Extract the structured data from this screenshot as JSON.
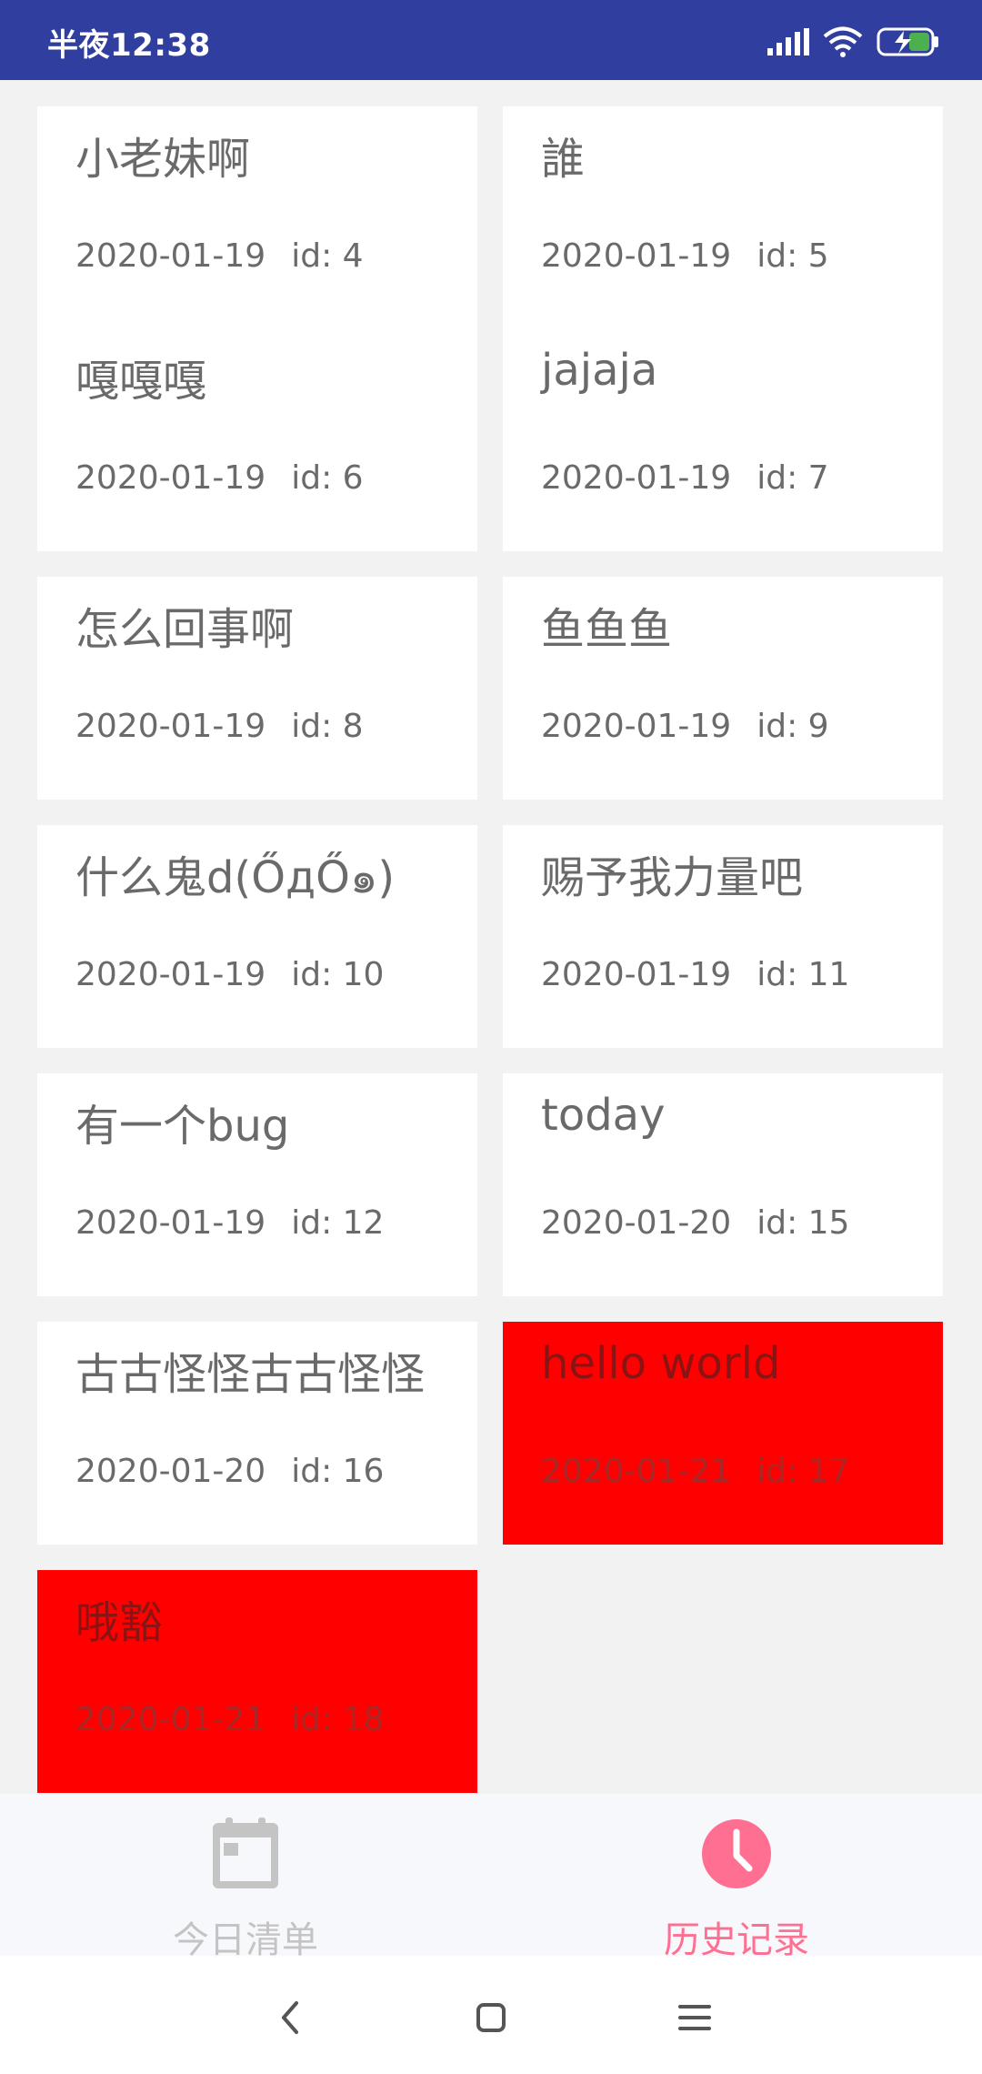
{
  "status_bar": {
    "time": "半夜12:38",
    "icons": [
      "signal-icon",
      "wifi-icon",
      "battery-charging-icon"
    ]
  },
  "cards": [
    {
      "title": "小老妹啊",
      "date": "2020-01-19",
      "id": "id: 4",
      "highlight": false
    },
    {
      "title": "誰",
      "date": "2020-01-19",
      "id": "id: 5",
      "highlight": false
    },
    {
      "title": "嘎嘎嘎",
      "date": "2020-01-19",
      "id": "id: 6",
      "highlight": false
    },
    {
      "title": "jajaja",
      "date": "2020-01-19",
      "id": "id: 7",
      "highlight": false
    },
    {
      "title": "怎么回事啊",
      "date": "2020-01-19",
      "id": "id: 8",
      "highlight": false
    },
    {
      "title": "鱼鱼鱼",
      "date": "2020-01-19",
      "id": "id: 9",
      "highlight": false
    },
    {
      "title": "什么鬼d(ŐдŐ๑)",
      "date": "2020-01-19",
      "id": "id: 10",
      "highlight": false
    },
    {
      "title": "赐予我力量吧",
      "date": "2020-01-19",
      "id": "id: 11",
      "highlight": false
    },
    {
      "title": "有一个bug",
      "date": "2020-01-19",
      "id": "id: 12",
      "highlight": false
    },
    {
      "title": "today",
      "date": "2020-01-20",
      "id": "id: 15",
      "highlight": false
    },
    {
      "title": "古古怪怪古古怪怪",
      "date": "2020-01-20",
      "id": "id: 16",
      "highlight": false
    },
    {
      "title": "hello world",
      "date": "2020-01-21",
      "id": "id: 17",
      "highlight": true
    },
    {
      "title": "哦豁",
      "date": "2020-01-21",
      "id": "id: 18",
      "highlight": true
    }
  ],
  "colors": {
    "status_bar": "#303f9f",
    "highlight_card": "#ff0000",
    "active_tab": "#ff6f91",
    "inactive_tab": "#c4c4c4"
  },
  "bottom_nav": {
    "today_label": "今日清单",
    "history_label": "历史记录",
    "active": "history"
  },
  "system_nav": [
    "back-icon",
    "home-icon",
    "menu-icon"
  ]
}
